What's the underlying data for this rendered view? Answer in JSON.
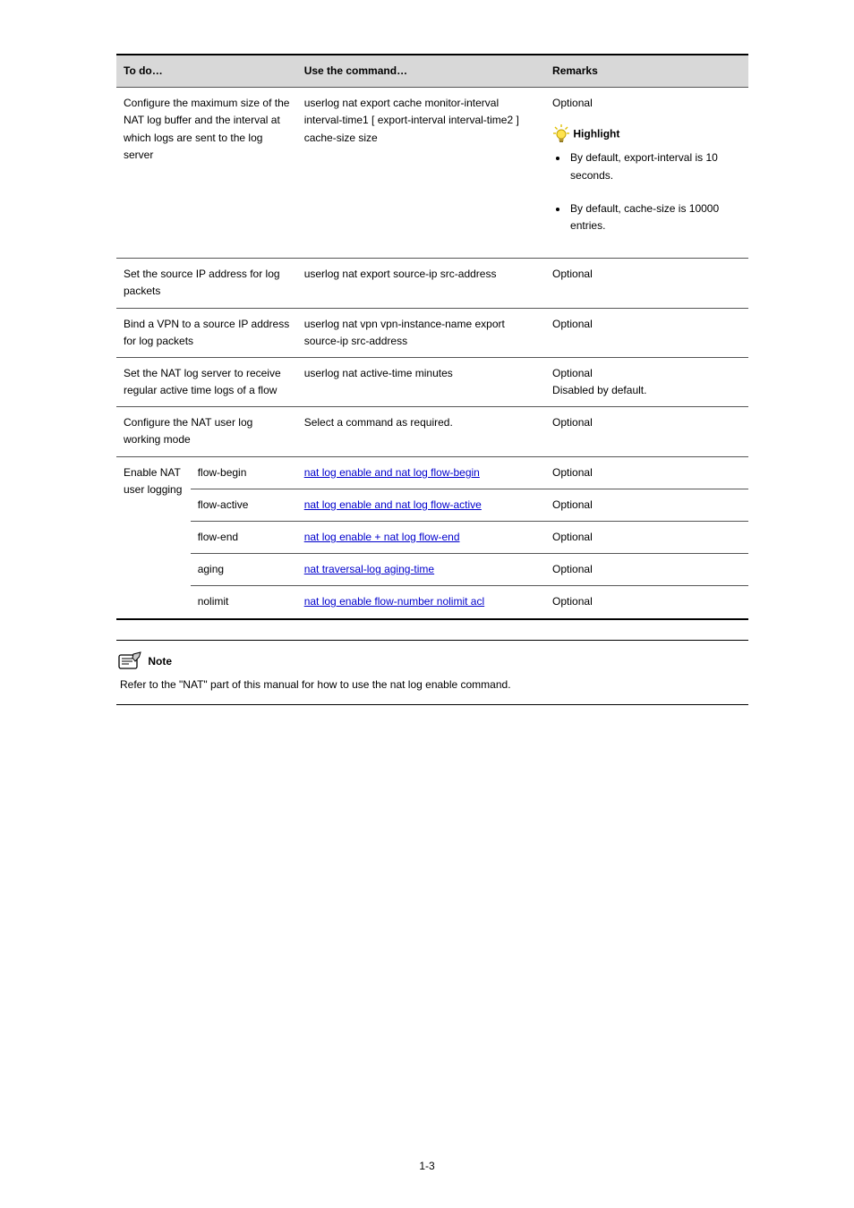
{
  "table": {
    "headers": {
      "c1": "To do…",
      "c2": "Use the command…",
      "c3": "Remarks"
    },
    "row_highlight": {
      "c1": "Configure the maximum size of the NAT log buffer and the interval at which logs are sent to the log server",
      "c2": "userlog nat export cache monitor-interval interval-time1 [ export-interval interval-time2 ] cache-size size",
      "c3_pre": "Optional",
      "c3_label": "Highlight",
      "c3_bullets": [
        {
          "text": "By default, export-interval is 10 seconds."
        },
        {
          "text": "By default, cache-size is 10000 entries."
        }
      ]
    },
    "row_source": {
      "c1": "Set the source IP address for log packets",
      "c2": "userlog nat export source-ip src-address",
      "c3": "Optional"
    },
    "row_vpn": {
      "c1": "Bind a VPN to a source IP address for log packets",
      "c2": "userlog nat vpn vpn-instance-name export source-ip src-address",
      "c3": "Optional"
    },
    "row_active": {
      "c1": "Set the NAT log server to receive regular active time logs of a flow",
      "c2": "userlog nat active-time minutes",
      "c3": "Optional\nDisabled by default."
    },
    "row_mode": {
      "c1": "Configure the NAT user log working mode",
      "c2": "Select a command as required.",
      "c3": "Optional"
    },
    "row_refs": {
      "group_label": "Enable NAT user logging",
      "rows": [
        {
          "sub": "flow-begin",
          "link": "nat log enable and nat log flow-begin",
          "rem": "Optional"
        },
        {
          "sub": "flow-active",
          "link": "nat log enable and nat log flow-active",
          "rem": "Optional"
        },
        {
          "sub": "flow-end",
          "link": "nat log enable + nat log flow-end",
          "rem": "Optional"
        },
        {
          "sub": "aging",
          "link": "nat traversal-log aging-time",
          "rem": "Optional"
        },
        {
          "sub": "nolimit",
          "link": "nat log enable flow-number nolimit acl",
          "rem": "Optional"
        }
      ]
    }
  },
  "note": {
    "label": "Note",
    "text": "Refer to the \"NAT\" part of this manual for how to use the nat log enable command."
  },
  "page_number": "1-3"
}
